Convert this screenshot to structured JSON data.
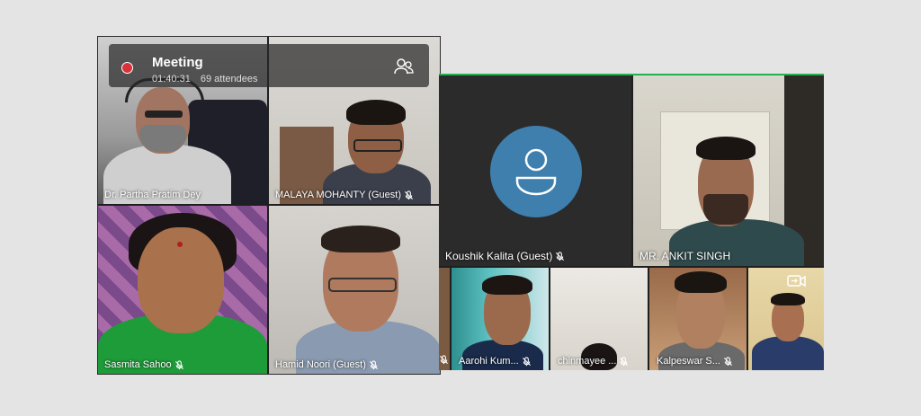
{
  "meeting": {
    "title": "Meeting",
    "duration": "01:40:31",
    "attendees": "69 attendees"
  },
  "participants": {
    "p1": {
      "name": "Dr. Partha Pratim Dey"
    },
    "p2": {
      "name": "MALAYA MOHANTY (Guest)"
    },
    "p3": {
      "name": "Sasmita Sahoo"
    },
    "p4": {
      "name": "Hamid Noori (Guest)"
    },
    "p5": {
      "name": "Koushik Kalita (Guest)"
    },
    "p6": {
      "name": "MR. ANKIT SINGH"
    },
    "p7": {
      "name": "Aarohi Kum..."
    },
    "p8": {
      "name": "chinmayee ..."
    },
    "p9": {
      "name": "Kalpeswar S..."
    }
  },
  "colors": {
    "record": "#d9323a",
    "active_border": "#22b14c",
    "avatar": "#3e7fae"
  },
  "icons": [
    "record-dot-icon",
    "attendees-icon",
    "mic-off-icon",
    "default-avatar-icon",
    "camera-switch-icon"
  ]
}
